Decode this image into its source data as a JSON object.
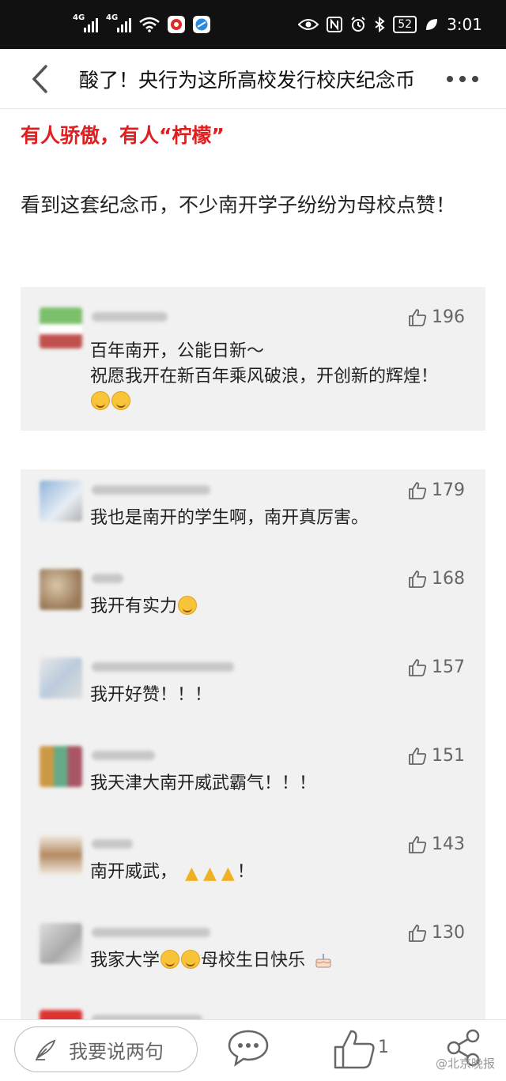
{
  "status_bar": {
    "network_1": "4G",
    "network_2": "4G",
    "battery": "52",
    "time": "3:01"
  },
  "header": {
    "title": "酸了！央行为这所高校发行校庆纪念币"
  },
  "article": {
    "subheading": "有人骄傲，有人“柠檬”",
    "paragraph": "看到这套纪念币，不少南开学子纷纷为母校点赞！"
  },
  "comments_group_1": [
    {
      "likes": "196",
      "text_1": "百年南开，公能日新～",
      "text_2": "祝愿我开在新百年乘风破浪，开创新的辉煌！"
    }
  ],
  "comments_group_2": [
    {
      "likes": "179",
      "text": "我也是南开的学生啊，南开真厉害。"
    },
    {
      "likes": "168",
      "text": "我开有实力"
    },
    {
      "likes": "157",
      "text": "我开好赞！！！"
    },
    {
      "likes": "151",
      "text": "我天津大南开威武霸气！！！"
    },
    {
      "likes": "143",
      "text_1": "南开威武，",
      "text_2": "！"
    },
    {
      "likes": "130",
      "text_1": "我家大学",
      "text_2": "母校生日快乐"
    }
  ],
  "bottom_bar": {
    "comment_placeholder": "我要说两句",
    "like_count": "1",
    "watermark": "@北京晚报"
  },
  "colors": {
    "accent_red": "#e02020",
    "card_bg": "#f1f1f1",
    "status_bar_bg": "#111111"
  }
}
